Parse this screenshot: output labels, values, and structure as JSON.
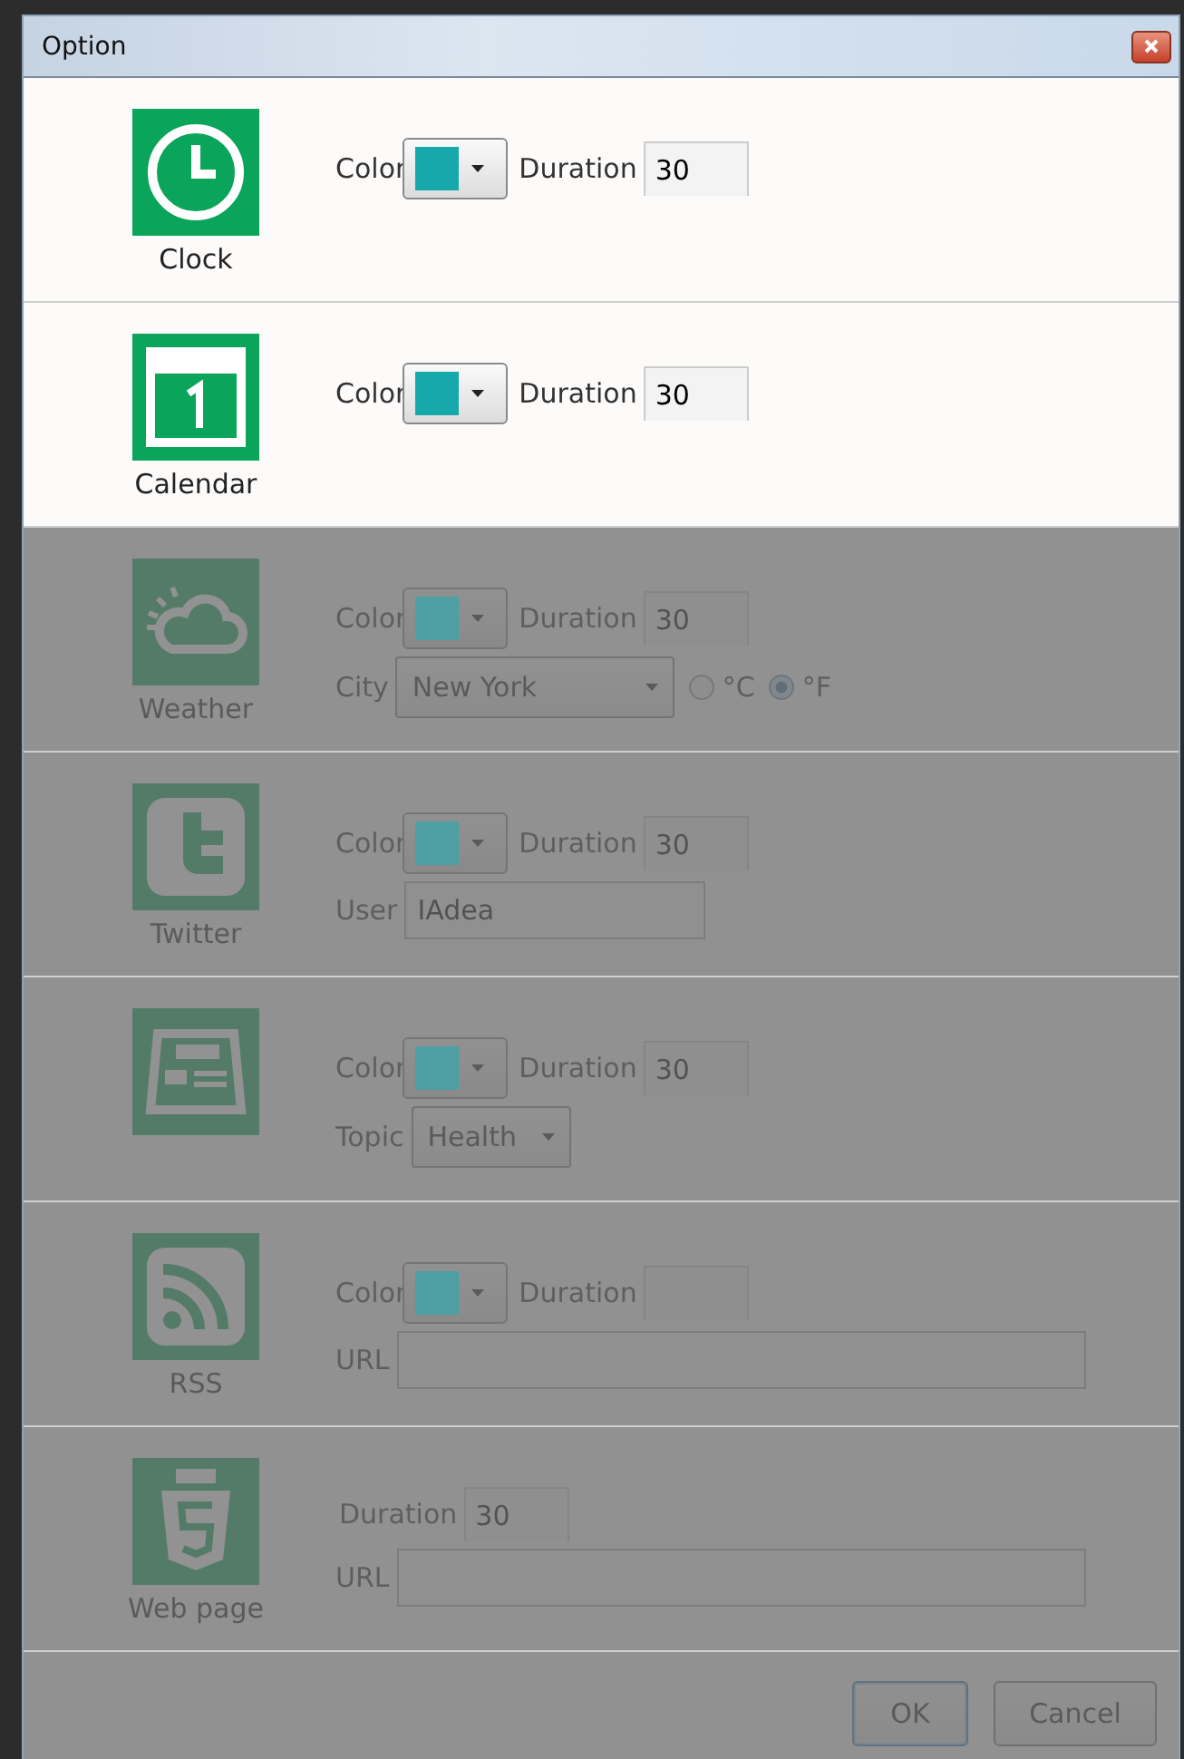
{
  "window": {
    "title": "Option"
  },
  "rows": [
    {
      "kind": "clock",
      "name": "Clock",
      "dimmed": false,
      "color_picker": {
        "label": "Color",
        "color": "#17a8ac"
      },
      "duration": {
        "label": "Duration",
        "value": "30"
      }
    },
    {
      "kind": "calendar",
      "name": "Calendar",
      "dimmed": false,
      "color_picker": {
        "label": "Color",
        "color": "#17a8ac"
      },
      "duration": {
        "label": "Duration",
        "value": "30"
      }
    },
    {
      "kind": "weather",
      "name": "Weather",
      "dimmed": true,
      "color_picker": {
        "label": "Color",
        "color": "#4e9fa3"
      },
      "duration": {
        "label": "Duration",
        "value": "30"
      },
      "extras": [
        {
          "kind": "select",
          "label": "City",
          "value": "New York",
          "wide": true
        },
        {
          "kind": "radio",
          "label": "°C",
          "selected": false
        },
        {
          "kind": "radio",
          "label": "°F",
          "selected": true
        }
      ]
    },
    {
      "kind": "twitter",
      "name": "Twitter",
      "dimmed": true,
      "color_picker": {
        "label": "Color",
        "color": "#4e9fa3"
      },
      "duration": {
        "label": "Duration",
        "value": "30"
      },
      "extras": [
        {
          "kind": "text",
          "label": "User",
          "value": "IAdea"
        }
      ]
    },
    {
      "kind": "news",
      "dimmed": true,
      "color_picker": {
        "label": "Color",
        "color": "#4e9fa3"
      },
      "duration": {
        "label": "Duration",
        "value": "30"
      },
      "extras": [
        {
          "kind": "select",
          "label": "Topic",
          "value": "Health",
          "wide": false
        }
      ]
    },
    {
      "kind": "rss",
      "name": "RSS",
      "dimmed": true,
      "color_picker": {
        "label": "Color",
        "color": "#4e9fa3"
      },
      "duration": {
        "label": "Duration"
      },
      "extras": [
        {
          "kind": "url",
          "label": "URL"
        }
      ]
    },
    {
      "kind": "html",
      "name": "Web page",
      "dimmed": true,
      "duration": {
        "label": "Duration",
        "value": "30"
      },
      "extras": [
        {
          "kind": "url",
          "label": "URL"
        }
      ]
    }
  ],
  "footer": {
    "dimmed": true,
    "buttons": [
      {
        "label": "OK",
        "default": true
      },
      {
        "label": "Cancel",
        "default": false
      }
    ]
  }
}
